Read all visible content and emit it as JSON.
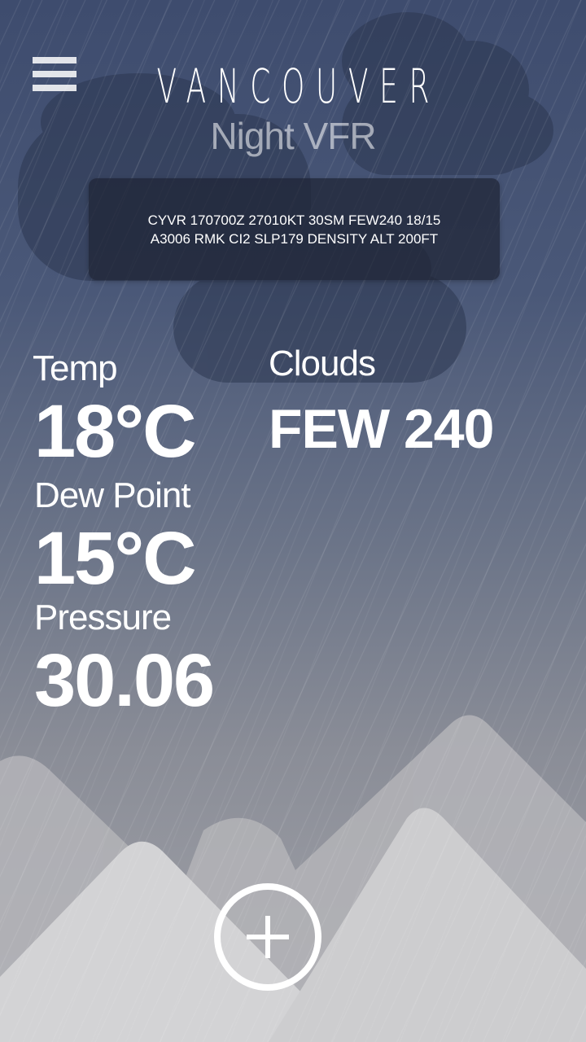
{
  "colors": {
    "sky_top": "#3e4c6e",
    "sky_bottom": "#a3a4aa",
    "metar_box": "#1e2434",
    "mountain_far": "#b2b2b6",
    "mountain_near": "#d4d4d6",
    "text": "#ffffff"
  },
  "header": {
    "menu_icon": "hamburger-menu-icon",
    "city": "VANCOUVER",
    "flight_rules": "Night VFR"
  },
  "metar": {
    "line1": "CYVR 170700Z 27010KT 30SM FEW240 18/15",
    "line2": "A3006 RMK CI2 SLP179 DENSITY ALT 200FT"
  },
  "conditions": {
    "temp_label": "Temp",
    "temp_value": "18°C",
    "dew_point_label": "Dew Point",
    "dew_point_value": "15°C",
    "pressure_label": "Pressure",
    "pressure_value": "30.06",
    "clouds_label": "Clouds",
    "clouds_value": "FEW 240"
  },
  "footer": {
    "add_icon": "plus-circle-icon"
  }
}
